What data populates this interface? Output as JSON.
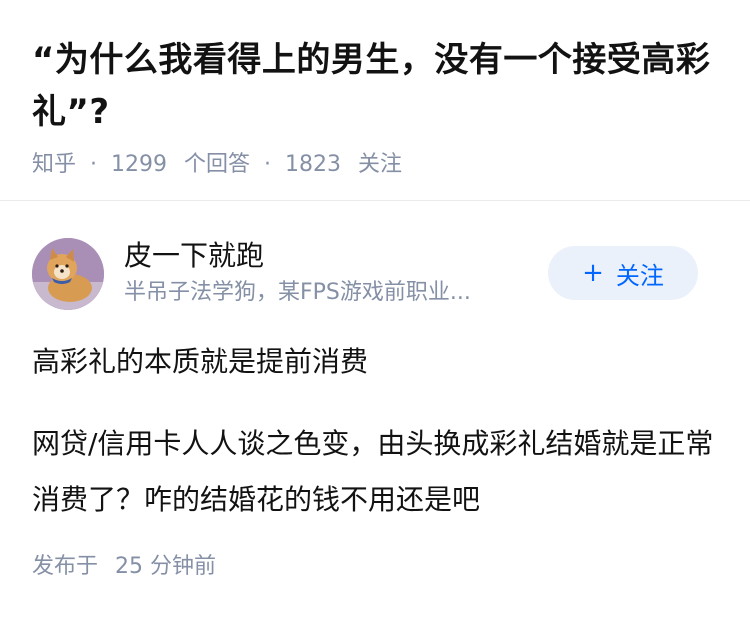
{
  "question": {
    "title": "“为什么我看得上的男生，没有一个接受高彩礼”?",
    "source": "知乎",
    "answers_count": "1299",
    "answers_label": "个回答",
    "follows_count": "1823",
    "follows_label": "关注",
    "separator": "·"
  },
  "answer": {
    "author": {
      "name": "皮一下就跑",
      "bio": "半吊子法学狗，某FPS游戏前职业...",
      "follow_label": "关注",
      "follow_icon": "plus-icon"
    },
    "paragraphs": [
      "高彩礼的本质就是提前消费",
      "网贷/信用卡人人谈之色变，由头换成彩礼结婚就是正常消费了？咋的结婚花的钱不用还是吧"
    ],
    "published_prefix": "发布于",
    "published_time": "25 分钟前"
  },
  "colors": {
    "accent": "#0066ff",
    "meta": "#8590a6",
    "follow_bg": "#ebf1fa"
  }
}
